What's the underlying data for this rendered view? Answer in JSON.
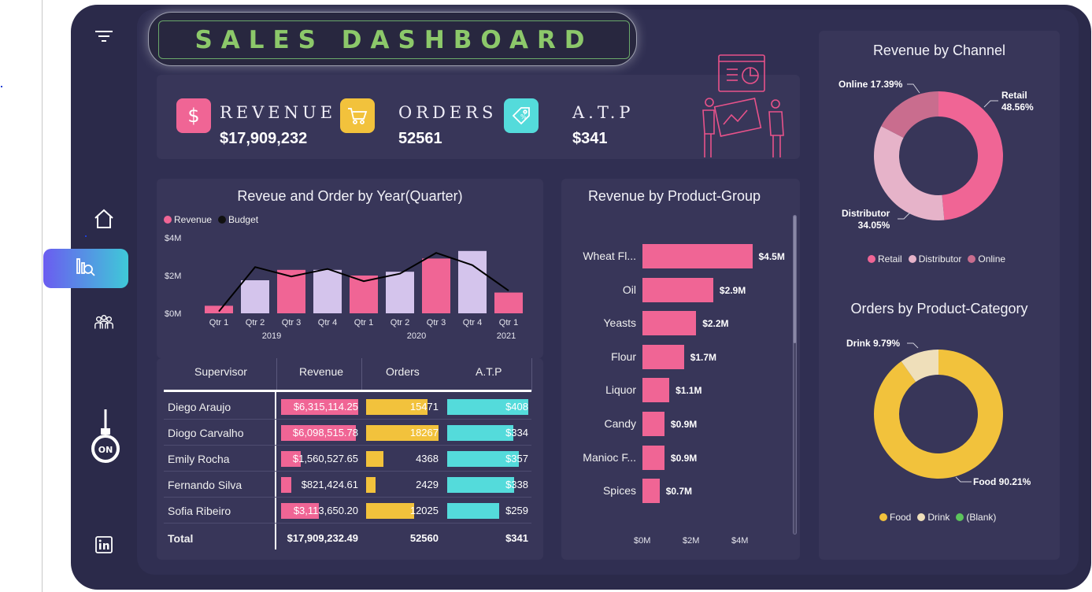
{
  "title": "SALES DASHBOARD",
  "kpis": {
    "revenue": {
      "label": "REVENUE",
      "value": "$17,909,232"
    },
    "orders": {
      "label": "ORDERS",
      "value": "52561"
    },
    "atp": {
      "label": "A.T.P",
      "value": "$341"
    }
  },
  "colors": {
    "pink": "#f06595",
    "lavender": "#d4c4ec",
    "yellow": "#f2c23c",
    "teal": "#54dbdb",
    "rose": "#c96d8e",
    "lightpink": "#e6b3c9",
    "cream": "#efdfba",
    "green": "#5cc45c"
  },
  "quarter_chart": {
    "title": "Reveue and Order by Year(Quarter)",
    "legend": [
      "Revenue",
      "Budget"
    ],
    "y_ticks": [
      "$4M",
      "$2M",
      "$0M"
    ],
    "quarters": [
      "Qtr 1",
      "Qtr 2",
      "Qtr 3",
      "Qtr 4",
      "Qtr 1",
      "Qtr 2",
      "Qtr 3",
      "Qtr 4",
      "Qtr 1"
    ],
    "years": [
      "2019",
      "2020",
      "2021"
    ],
    "chart_data": {
      "type": "bar",
      "categories": [
        "2019 Qtr 1",
        "2019 Qtr 2",
        "2019 Qtr 3",
        "2019 Qtr 4",
        "2020 Qtr 1",
        "2020 Qtr 2",
        "2020 Qtr 3",
        "2020 Qtr 4",
        "2021 Qtr 1"
      ],
      "series": [
        {
          "name": "Revenue",
          "values": [
            0.4,
            1.75,
            2.3,
            2.3,
            2.0,
            2.2,
            2.9,
            3.3,
            1.1
          ]
        },
        {
          "name": "Budget",
          "values": [
            0.1,
            2.45,
            1.95,
            2.35,
            1.7,
            2.1,
            3.2,
            2.55,
            1.2
          ]
        }
      ],
      "ylim": [
        0,
        4
      ]
    }
  },
  "product_chart": {
    "title": "Revenue by Product-Group",
    "chart_data": {
      "type": "bar",
      "categories": [
        "Wheat Fl...",
        "Oil",
        "Yeasts",
        "Flour",
        "Liquor",
        "Candy",
        "Manioc F...",
        "Spices"
      ],
      "values": [
        4.5,
        2.9,
        2.2,
        1.7,
        1.1,
        0.9,
        0.9,
        0.7
      ],
      "labels": [
        "$4.5M",
        "$2.9M",
        "$2.2M",
        "$1.7M",
        "$1.1M",
        "$0.9M",
        "$0.9M",
        "$0.7M"
      ],
      "x_ticks": [
        "$0M",
        "$2M",
        "$4M"
      ],
      "xlim": [
        0,
        4
      ]
    }
  },
  "table": {
    "headers": [
      "Supervisor",
      "Revenue",
      "Orders",
      "A.T.P"
    ],
    "rows": [
      {
        "name": "Diego Araujo",
        "revenue": "$6,315,114.25",
        "orders": "15471",
        "atp": "$408",
        "rev_frac": 1.0,
        "ord_frac": 0.85,
        "atp_frac": 1.0
      },
      {
        "name": "Diogo Carvalho",
        "revenue": "$6,098,515.78",
        "orders": "18267",
        "atp": "$334",
        "rev_frac": 0.97,
        "ord_frac": 1.0,
        "atp_frac": 0.82
      },
      {
        "name": "Emily Rocha",
        "revenue": "$1,560,527.65",
        "orders": "4368",
        "atp": "$357",
        "rev_frac": 0.25,
        "ord_frac": 0.24,
        "atp_frac": 0.88
      },
      {
        "name": "Fernando Silva",
        "revenue": "$821,424.61",
        "orders": "2429",
        "atp": "$338",
        "rev_frac": 0.13,
        "ord_frac": 0.13,
        "atp_frac": 0.83
      },
      {
        "name": "Sofia Ribeiro",
        "revenue": "$3,113,650.20",
        "orders": "12025",
        "atp": "$259",
        "rev_frac": 0.49,
        "ord_frac": 0.66,
        "atp_frac": 0.64
      }
    ],
    "total": {
      "label": "Total",
      "revenue": "$17,909,232.49",
      "orders": "52560",
      "atp": "$341"
    }
  },
  "channel_chart": {
    "title": "Revenue by Channel",
    "chart_data": {
      "type": "pie",
      "categories": [
        "Retail",
        "Distributor",
        "Online"
      ],
      "values": [
        48.56,
        34.05,
        17.39
      ]
    },
    "labels": {
      "retail": "Retail",
      "retail_pct": "48.56%",
      "distributor": "Distributor",
      "distributor_pct": "34.05%",
      "online": "Online 17.39%"
    },
    "legend": [
      "Retail",
      "Distributor",
      "Online"
    ]
  },
  "category_chart": {
    "title": "Orders by Product-Category",
    "chart_data": {
      "type": "pie",
      "categories": [
        "Food",
        "Drink",
        "(Blank)"
      ],
      "values": [
        90.21,
        9.79,
        0
      ]
    },
    "labels": {
      "food": "Food 90.21%",
      "drink": "Drink 9.79%"
    },
    "legend": [
      "Food",
      "Drink",
      "(Blank)"
    ]
  },
  "sidebar": {
    "icons": [
      "filter-icon",
      "home-icon",
      "analytics-icon",
      "team-icon",
      "bulb-on-icon",
      "linkedin-icon"
    ],
    "bulb_text": "ON"
  }
}
